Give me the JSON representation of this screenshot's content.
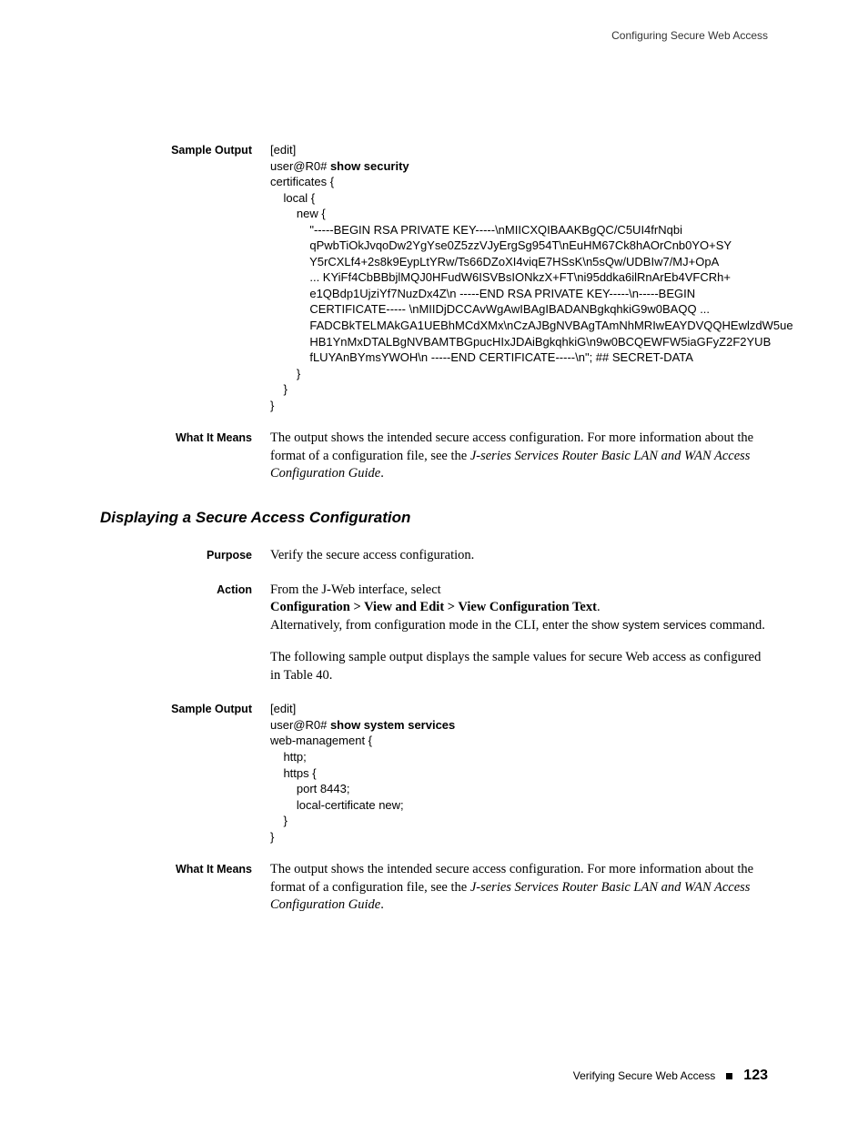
{
  "header": {
    "title": "Configuring Secure Web Access"
  },
  "sections": {
    "sample_output_1": {
      "label": "Sample Output",
      "line1": "[edit]",
      "line2a": "user@R0# ",
      "line2b": "show security",
      "line3": "certificates {",
      "line4": "    local {",
      "line5": "        new {",
      "line6": "            \"-----BEGIN RSA PRIVATE KEY-----\\nMIICXQIBAAKBgQC/C5UI4frNqbi",
      "line7": "            qPwbTiOkJvqoDw2YgYse0Z5zzVJyErgSg954T\\nEuHM67Ck8hAOrCnb0YO+SY",
      "line8": "            Y5rCXLf4+2s8k9EypLtYRw/Ts66DZoXI4viqE7HSsK\\n5sQw/UDBIw7/MJ+OpA",
      "line9": "            ... KYiFf4CbBBbjlMQJ0HFudW6ISVBsIONkzX+FT\\ni95ddka6ilRnArEb4VFCRh+",
      "line10": "            e1QBdp1UjziYf7NuzDx4Z\\n -----END RSA PRIVATE KEY-----\\n-----BEGIN",
      "line11": "            CERTIFICATE----- \\nMIIDjDCCAvWgAwIBAgIBADANBgkqhkiG9w0BAQQ ...",
      "line12": "            FADCBkTELMAkGA1UEBhMCdXMx\\nCzAJBgNVBAgTAmNhMRIwEAYDVQQHEwlzdW5ue",
      "line13": "            HB1YnMxDTALBgNVBAMTBGpucHIxJDAiBgkqhkiG\\n9w0BCQEWFW5iaGFyZ2F2YUB",
      "line14": "            fLUYAnBYmsYWOH\\n -----END CERTIFICATE-----\\n\"; ## SECRET-DATA",
      "line15": "        }",
      "line16": "    }",
      "line17": "}"
    },
    "what_it_means_1": {
      "label": "What It Means",
      "text_a": "The output shows the intended secure access configuration. For more information about the format of a configuration file, see the ",
      "text_b": "J-series Services Router Basic LAN and WAN Access Configuration Guide",
      "text_c": "."
    },
    "heading": "Displaying a Secure Access Configuration",
    "purpose": {
      "label": "Purpose",
      "text": "Verify the secure access configuration."
    },
    "action": {
      "label": "Action",
      "line1": "From the J-Web interface, select ",
      "line2": "Configuration > View and Edit > View Configuration Text",
      "line2_end": ".",
      "line3a": "Alternatively, from configuration mode in the CLI, enter the ",
      "line3b": "show system services",
      "line3c": " command.",
      "para2": "The following sample output displays the sample values for secure Web access as configured in Table 40."
    },
    "sample_output_2": {
      "label": "Sample Output",
      "line1": "[edit]",
      "line2a": "user@R0# ",
      "line2b": "show system services",
      "line3": "web-management {",
      "line4": "    http;",
      "line5": "    https {",
      "line6": "        port 8443;",
      "line7": "        local-certificate new;",
      "line8": "    }",
      "line9": "}"
    },
    "what_it_means_2": {
      "label": "What It Means",
      "text_a": "The output shows the intended secure access configuration. For more information about the format of a configuration file, see the ",
      "text_b": "J-series Services Router Basic LAN and WAN Access Configuration Guide",
      "text_c": "."
    }
  },
  "footer": {
    "text": "Verifying Secure Web Access",
    "page": "123"
  }
}
